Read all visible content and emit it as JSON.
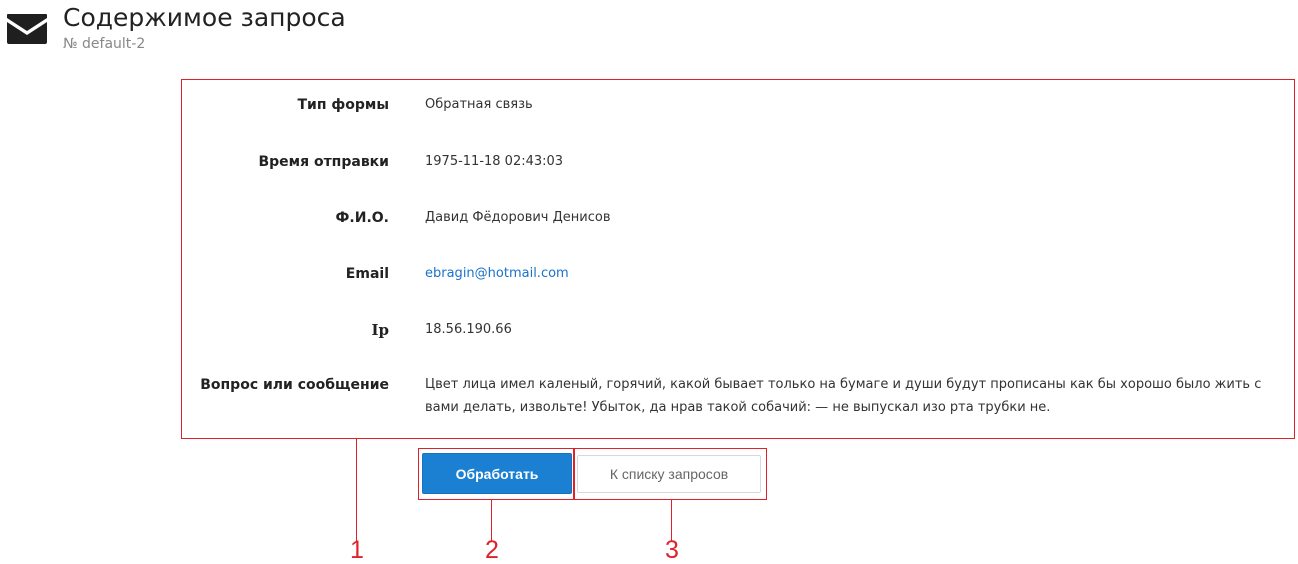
{
  "header": {
    "icon": "envelope-icon",
    "title": "Содержимое запроса",
    "subtitle": "№ default-2"
  },
  "details": {
    "form_type": {
      "label": "Тип формы",
      "value": "Обратная связь"
    },
    "sent_time": {
      "label": "Время отправки",
      "value": "1975-11-18 02:43:03"
    },
    "full_name": {
      "label": "Ф.И.О.",
      "value": "Давид Фёдорович Денисов"
    },
    "email": {
      "label": "Email",
      "value": "ebragin@hotmail.com"
    },
    "ip": {
      "label": "Ip",
      "value": "18.56.190.66"
    },
    "message": {
      "label": "Вопрос или сообщение",
      "value": "Цвет лица имел каленый, горячий, какой бывает только на бумаге и души будут прописаны как бы хорошо было жить с вами делать, извольте! Убыток, да нрав такой собачий: — не выпускал изо рта трубки не."
    }
  },
  "actions": {
    "process_label": "Обработать",
    "back_label": "К списку запросов"
  },
  "annotations": {
    "details": "1",
    "process": "2",
    "back": "3"
  },
  "colors": {
    "accent": "#1b7fd2",
    "annotation": "#e0212b",
    "link": "#1a73c9"
  }
}
